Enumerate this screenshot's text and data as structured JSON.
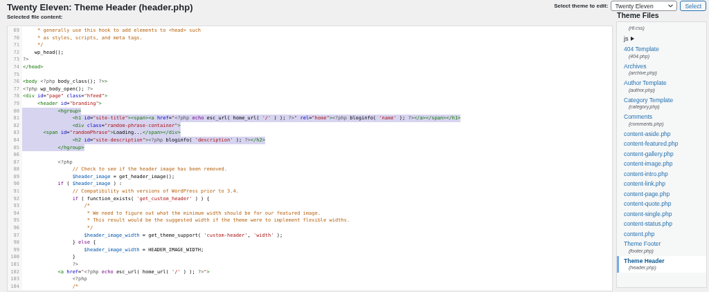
{
  "header": {
    "title": "Twenty Eleven: Theme Header (header.php)",
    "theme_picker": {
      "label": "Select theme to edit:",
      "value": "Twenty Eleven",
      "button": "Select"
    }
  },
  "editor": {
    "label": "Selected file content:",
    "lines": [
      {
        "number": "69",
        "selected": false,
        "tokens": [
          {
            "kind": "comment",
            "text": "     * generally use this hook to add elements to <head> such"
          }
        ]
      },
      {
        "number": "70",
        "selected": false,
        "tokens": [
          {
            "kind": "comment",
            "text": "     * as styles, scripts, and meta tags."
          }
        ]
      },
      {
        "number": "71",
        "selected": false,
        "tokens": [
          {
            "kind": "comment",
            "text": "     */"
          }
        ]
      },
      {
        "number": "72",
        "selected": false,
        "tokens": [
          {
            "kind": "plain",
            "text": "    wp_head();"
          }
        ]
      },
      {
        "number": "73",
        "selected": false,
        "tokens": [
          {
            "kind": "meta",
            "text": "?>"
          }
        ]
      },
      {
        "number": "74",
        "selected": false,
        "tokens": [
          {
            "kind": "tag",
            "text": "</head>"
          }
        ]
      },
      {
        "number": "75",
        "selected": false
      },
      {
        "number": "76",
        "selected": false,
        "tokens": [
          {
            "kind": "tag",
            "text": "<body "
          },
          {
            "kind": "meta",
            "text": "<?php"
          },
          {
            "kind": "plain",
            "text": " body_class(); "
          },
          {
            "kind": "meta",
            "text": "?>"
          },
          {
            "kind": "tag",
            "text": ">"
          }
        ]
      },
      {
        "number": "77",
        "selected": false,
        "tokens": [
          {
            "kind": "meta",
            "text": "<?php"
          },
          {
            "kind": "plain",
            "text": " wp_body_open(); "
          },
          {
            "kind": "meta",
            "text": "?>"
          }
        ]
      },
      {
        "number": "78",
        "selected": false,
        "tokens": [
          {
            "kind": "tag",
            "text": "<div "
          },
          {
            "kind": "attr",
            "text": "id"
          },
          {
            "kind": "plain",
            "text": "="
          },
          {
            "kind": "string",
            "text": "\"page\""
          },
          {
            "kind": "attr",
            "text": " class"
          },
          {
            "kind": "plain",
            "text": "="
          },
          {
            "kind": "string",
            "text": "\"hfeed\""
          },
          {
            "kind": "tag",
            "text": ">"
          }
        ]
      },
      {
        "number": "79",
        "selected": false,
        "tokens": [
          {
            "kind": "tag",
            "text": "     <header "
          },
          {
            "kind": "attr",
            "text": "id"
          },
          {
            "kind": "plain",
            "text": "="
          },
          {
            "kind": "string",
            "text": "\"branding\""
          },
          {
            "kind": "tag",
            "text": ">"
          }
        ]
      },
      {
        "number": "80",
        "selected": true,
        "tokens": [
          {
            "kind": "tag",
            "text": "            <hgroup>"
          }
        ]
      },
      {
        "number": "81",
        "selected": true,
        "tokens": [
          {
            "kind": "tag",
            "text": "                 <h1 "
          },
          {
            "kind": "attr",
            "text": "id"
          },
          {
            "kind": "plain",
            "text": "="
          },
          {
            "kind": "string",
            "text": "\"site-title\""
          },
          {
            "kind": "tag",
            "text": "><span><a "
          },
          {
            "kind": "attr",
            "text": "href"
          },
          {
            "kind": "plain",
            "text": "="
          },
          {
            "kind": "string",
            "text": "\""
          },
          {
            "kind": "meta",
            "text": "<?php"
          },
          {
            "kind": "keyword",
            "text": " echo"
          },
          {
            "kind": "plain",
            "text": " esc_url( home_url( "
          },
          {
            "kind": "string",
            "text": "'/'"
          },
          {
            "kind": "plain",
            "text": " ) ); "
          },
          {
            "kind": "meta",
            "text": "?>"
          },
          {
            "kind": "string",
            "text": "\""
          },
          {
            "kind": "attr",
            "text": " rel"
          },
          {
            "kind": "plain",
            "text": "="
          },
          {
            "kind": "string",
            "text": "\"home\""
          },
          {
            "kind": "tag",
            "text": ">"
          },
          {
            "kind": "meta",
            "text": "<?php"
          },
          {
            "kind": "plain",
            "text": " bloginfo( "
          },
          {
            "kind": "string",
            "text": "'name'"
          },
          {
            "kind": "plain",
            "text": " ); "
          },
          {
            "kind": "meta",
            "text": "?>"
          },
          {
            "kind": "tag",
            "text": "</a></span></h1>"
          }
        ]
      },
      {
        "number": "82",
        "selected": true,
        "tokens": [
          {
            "kind": "tag",
            "text": "                 <div "
          },
          {
            "kind": "attr",
            "text": "class"
          },
          {
            "kind": "plain",
            "text": "="
          },
          {
            "kind": "string",
            "text": "\"random-phrase-container\""
          },
          {
            "kind": "tag",
            "text": ">"
          }
        ]
      },
      {
        "number": "83",
        "selected": true,
        "tokens": [
          {
            "kind": "tag",
            "text": "       <span "
          },
          {
            "kind": "attr",
            "text": "id"
          },
          {
            "kind": "plain",
            "text": "="
          },
          {
            "kind": "string",
            "text": "\"randomPhrase\""
          },
          {
            "kind": "tag",
            "text": ">"
          },
          {
            "kind": "plain",
            "text": "Loading..."
          },
          {
            "kind": "tag",
            "text": "</span></div>"
          }
        ]
      },
      {
        "number": "84",
        "selected": true,
        "tokens": [
          {
            "kind": "tag",
            "text": "                 <h2 "
          },
          {
            "kind": "attr",
            "text": "id"
          },
          {
            "kind": "plain",
            "text": "="
          },
          {
            "kind": "string",
            "text": "\"site-description\""
          },
          {
            "kind": "tag",
            "text": ">"
          },
          {
            "kind": "meta",
            "text": "<?php"
          },
          {
            "kind": "plain",
            "text": " bloginfo( "
          },
          {
            "kind": "string",
            "text": "'description'"
          },
          {
            "kind": "plain",
            "text": " ); "
          },
          {
            "kind": "meta",
            "text": "?>"
          },
          {
            "kind": "tag",
            "text": "</h2>"
          }
        ]
      },
      {
        "number": "85",
        "selected": true,
        "tokens": [
          {
            "kind": "tag",
            "text": "            </hgroup>"
          }
        ]
      },
      {
        "number": "86",
        "selected": false
      },
      {
        "number": "87",
        "selected": false,
        "tokens": [
          {
            "kind": "meta",
            "text": "            <?php"
          }
        ]
      },
      {
        "number": "88",
        "selected": false,
        "tokens": [
          {
            "kind": "comment",
            "text": "                 // Check to see if the header image has been removed."
          }
        ]
      },
      {
        "number": "89",
        "selected": false,
        "tokens": [
          {
            "kind": "variable",
            "text": "                 $header_image"
          },
          {
            "kind": "plain",
            "text": " = get_header_image();"
          }
        ]
      },
      {
        "number": "90",
        "selected": false,
        "tokens": [
          {
            "kind": "keyword",
            "text": "            if"
          },
          {
            "kind": "plain",
            "text": " ( "
          },
          {
            "kind": "variable",
            "text": "$header_image"
          },
          {
            "kind": "plain",
            "text": " ) :"
          }
        ]
      },
      {
        "number": "91",
        "selected": false,
        "tokens": [
          {
            "kind": "comment",
            "text": "                 // Compatibility with versions of WordPress prior to 3.4."
          }
        ]
      },
      {
        "number": "92",
        "selected": false,
        "tokens": [
          {
            "kind": "keyword",
            "text": "                 if"
          },
          {
            "kind": "plain",
            "text": " ( function_exists( "
          },
          {
            "kind": "string",
            "text": "'get_custom_header'"
          },
          {
            "kind": "plain",
            "text": " ) ) {"
          }
        ]
      },
      {
        "number": "93",
        "selected": false,
        "tokens": [
          {
            "kind": "comment",
            "text": "                     /*"
          }
        ]
      },
      {
        "number": "94",
        "selected": false,
        "tokens": [
          {
            "kind": "comment",
            "text": "                      * We need to figure out what the minimum width should be for our featured image."
          }
        ]
      },
      {
        "number": "95",
        "selected": false,
        "tokens": [
          {
            "kind": "comment",
            "text": "                      * This result would be the suggested width if the theme were to implement flexible widths."
          }
        ]
      },
      {
        "number": "96",
        "selected": false,
        "tokens": [
          {
            "kind": "comment",
            "text": "                      */"
          }
        ]
      },
      {
        "number": "97",
        "selected": false,
        "tokens": [
          {
            "kind": "variable",
            "text": "                     $header_image_width"
          },
          {
            "kind": "plain",
            "text": " = get_theme_support( "
          },
          {
            "kind": "string",
            "text": "'custom-header'"
          },
          {
            "kind": "plain",
            "text": ", "
          },
          {
            "kind": "string",
            "text": "'width'"
          },
          {
            "kind": "plain",
            "text": " );"
          }
        ]
      },
      {
        "number": "98",
        "selected": false,
        "tokens": [
          {
            "kind": "plain",
            "text": "                 } "
          },
          {
            "kind": "keyword",
            "text": "else"
          },
          {
            "kind": "plain",
            "text": " {"
          }
        ]
      },
      {
        "number": "99",
        "selected": false,
        "tokens": [
          {
            "kind": "variable",
            "text": "                     $header_image_width"
          },
          {
            "kind": "plain",
            "text": " = HEADER_IMAGE_WIDTH;"
          }
        ]
      },
      {
        "number": "100",
        "selected": false,
        "tokens": [
          {
            "kind": "plain",
            "text": "                 }"
          }
        ]
      },
      {
        "number": "101",
        "selected": false,
        "tokens": [
          {
            "kind": "meta",
            "text": "                 ?>"
          }
        ]
      },
      {
        "number": "102",
        "selected": false,
        "tokens": [
          {
            "kind": "tag",
            "text": "            <a "
          },
          {
            "kind": "attr",
            "text": "href"
          },
          {
            "kind": "plain",
            "text": "="
          },
          {
            "kind": "string",
            "text": "\""
          },
          {
            "kind": "meta",
            "text": "<?php"
          },
          {
            "kind": "keyword",
            "text": " echo"
          },
          {
            "kind": "plain",
            "text": " esc_url( home_url( "
          },
          {
            "kind": "string",
            "text": "'/'"
          },
          {
            "kind": "plain",
            "text": " ) ); "
          },
          {
            "kind": "meta",
            "text": "?>"
          },
          {
            "kind": "string",
            "text": "\""
          },
          {
            "kind": "tag",
            "text": ">"
          }
        ]
      },
      {
        "number": "103",
        "selected": false,
        "tokens": [
          {
            "kind": "meta",
            "text": "                 <?php"
          }
        ]
      },
      {
        "number": "104",
        "selected": false,
        "tokens": [
          {
            "kind": "comment",
            "text": "                 /*"
          }
        ]
      }
    ]
  },
  "sidebar": {
    "title": "Theme Files",
    "items": [
      {
        "kind": "file",
        "file": "(rtl.css)",
        "selected": false
      },
      {
        "kind": "folder",
        "label": "js",
        "selected": false
      },
      {
        "kind": "file",
        "label": "404 Template",
        "file": "(404.php)",
        "selected": false
      },
      {
        "kind": "file",
        "label": "Archives",
        "file": "(archive.php)",
        "selected": false
      },
      {
        "kind": "file",
        "label": "Author Template",
        "file": "(author.php)",
        "selected": false
      },
      {
        "kind": "file",
        "label": "Category Template",
        "file": "(category.php)",
        "selected": false
      },
      {
        "kind": "file",
        "label": "Comments",
        "file": "(comments.php)",
        "selected": false
      },
      {
        "kind": "file",
        "label": "content-aside.php",
        "selected": false
      },
      {
        "kind": "file",
        "label": "content-featured.php",
        "selected": false
      },
      {
        "kind": "file",
        "label": "content-gallery.php",
        "selected": false
      },
      {
        "kind": "file",
        "label": "content-image.php",
        "selected": false
      },
      {
        "kind": "file",
        "label": "content-intro.php",
        "selected": false
      },
      {
        "kind": "file",
        "label": "content-link.php",
        "selected": false
      },
      {
        "kind": "file",
        "label": "content-page.php",
        "selected": false
      },
      {
        "kind": "file",
        "label": "content-quote.php",
        "selected": false
      },
      {
        "kind": "file",
        "label": "content-single.php",
        "selected": false
      },
      {
        "kind": "file",
        "label": "content-status.php",
        "selected": false
      },
      {
        "kind": "file",
        "label": "content.php",
        "selected": false
      },
      {
        "kind": "file",
        "label": "Theme Footer",
        "file": "(footer.php)",
        "selected": false
      },
      {
        "kind": "file",
        "label": "Theme Header",
        "file": "(header.php)",
        "selected": true
      }
    ]
  }
}
